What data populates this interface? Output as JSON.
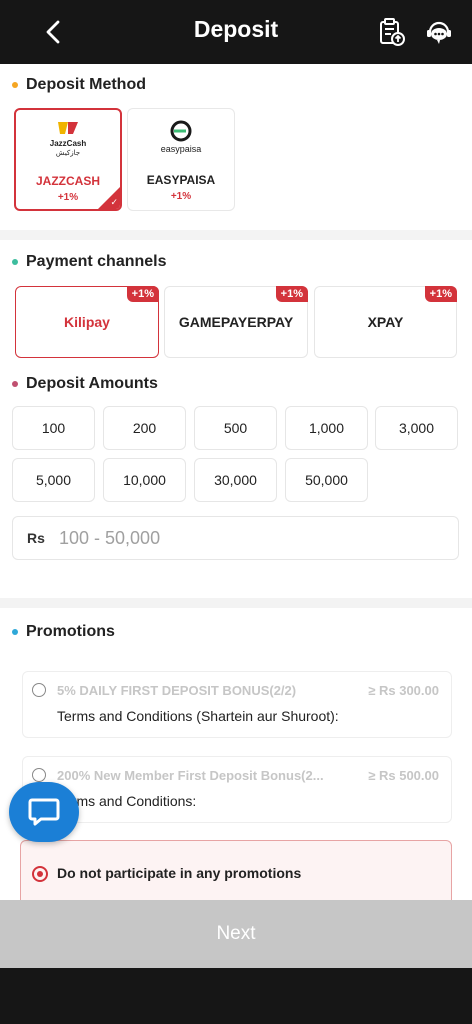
{
  "header": {
    "title": "Deposit",
    "back_icon": "chevron-left-icon",
    "history_icon": "clipboard-upload-icon",
    "support_icon": "headset-chat-icon"
  },
  "deposit_method": {
    "title": "Deposit Method",
    "dot_color": "#f5a623",
    "methods": [
      {
        "name": "JAZZCASH",
        "bonus": "+1%",
        "logo_text_1": "JazzCash",
        "logo_text_2": "جازکیش",
        "selected": true
      },
      {
        "name": "EASYPAISA",
        "bonus": "+1%",
        "logo_text_1": "easypaisa",
        "selected": false
      }
    ]
  },
  "payment_channels": {
    "title": "Payment channels",
    "dot_color": "#3dbd9e",
    "channels": [
      {
        "name": "Kilipay",
        "badge": "+1%",
        "selected": true
      },
      {
        "name": "GAMEPAYERPAY",
        "badge": "+1%",
        "selected": false
      },
      {
        "name": "XPAY",
        "badge": "+1%",
        "selected": false
      }
    ]
  },
  "deposit_amounts": {
    "title": "Deposit Amounts",
    "dot_color": "#c05070",
    "amounts": [
      "100",
      "200",
      "500",
      "1,000",
      "3,000",
      "5,000",
      "10,000",
      "30,000",
      "50,000"
    ],
    "currency_label": "Rs",
    "input_value": "",
    "input_placeholder": "100 - 50,000"
  },
  "promotions": {
    "title": "Promotions",
    "dot_color": "#2fa8d8",
    "items": [
      {
        "title": "5% DAILY FIRST DEPOSIT BONUS(2/2)",
        "amount": "≥ Rs 300.00",
        "terms": "Terms and Conditions (Shartein aur Shuroot):"
      },
      {
        "title": "200% New Member First Deposit Bonus(2...",
        "amount": "≥ Rs 500.00",
        "terms": "Terms and Conditions:"
      }
    ],
    "no_participate": "Do not participate in any promotions"
  },
  "footer": {
    "next_label": "Next"
  },
  "colors": {
    "accent": "#d3333b",
    "header_bg": "#161616",
    "fab_blue": "#1b7fd6"
  }
}
